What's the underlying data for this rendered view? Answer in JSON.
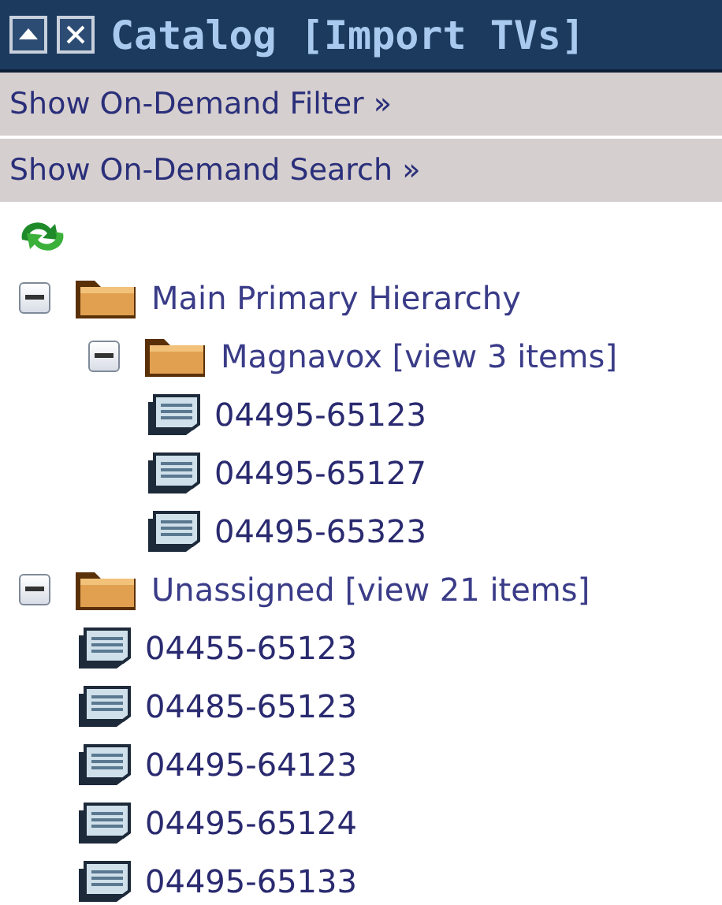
{
  "window": {
    "title": "Catalog [Import TVs]"
  },
  "links": [
    {
      "label": "Show On-Demand Filter »"
    },
    {
      "label": "Show On-Demand Search »"
    }
  ],
  "tree": [
    {
      "kind": "folder",
      "label": "Main Primary Hierarchy",
      "expanded": true,
      "children": [
        {
          "kind": "folder",
          "label": "Magnavox [view 3 items]",
          "expanded": true,
          "children": [
            {
              "kind": "item",
              "label": "04495-65123"
            },
            {
              "kind": "item",
              "label": "04495-65127"
            },
            {
              "kind": "item",
              "label": "04495-65323"
            }
          ]
        }
      ]
    },
    {
      "kind": "folder",
      "label": "Unassigned [view 21 items]",
      "expanded": true,
      "children": [
        {
          "kind": "item",
          "label": "04455-65123"
        },
        {
          "kind": "item",
          "label": "04485-65123"
        },
        {
          "kind": "item",
          "label": "04495-64123"
        },
        {
          "kind": "item",
          "label": "04495-65124"
        },
        {
          "kind": "item",
          "label": "04495-65133"
        }
      ]
    }
  ]
}
